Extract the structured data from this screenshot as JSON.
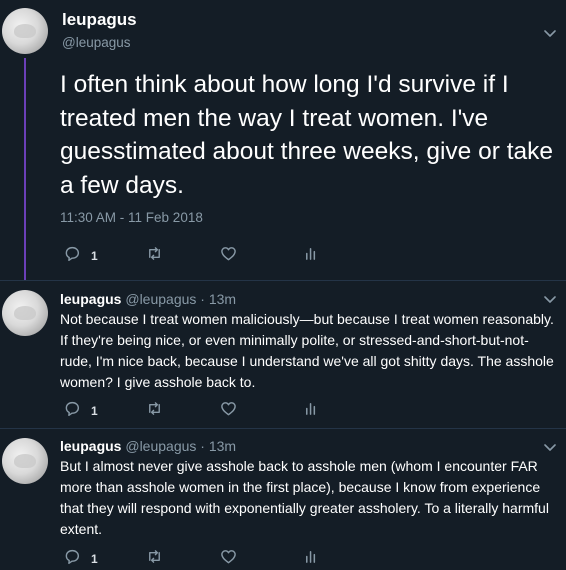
{
  "main_tweet": {
    "name": "leupagus",
    "handle": "@leupagus",
    "text": "I often think about how long I'd survive if I treated men the way I treat women. I've guesstimated about three weeks, give or take a few days.",
    "timestamp": "11:30 AM - 11 Feb 2018",
    "reply_count": "1",
    "icons": [
      "reply-icon",
      "retweet-icon",
      "like-icon",
      "analytics-icon",
      "chevron-down-icon"
    ]
  },
  "replies": [
    {
      "name": "leupagus",
      "handle": "@leupagus",
      "separator": " · ",
      "time": "13m",
      "text": "Not because I treat women maliciously—but because I treat women reasonably. If they're being nice, or even minimally polite, or stressed-and-short-but-not-rude, I'm nice back, because I understand we've all got shitty days. The asshole women? I give asshole back to.",
      "reply_count": "1"
    },
    {
      "name": "leupagus",
      "handle": "@leupagus",
      "separator": " · ",
      "time": "13m",
      "text": "But I almost never give asshole back to asshole men (whom I encounter FAR more than asshole women in the first place), because I know from experience that they will respond with exponentially greater assholery. To a literally harmful extent.",
      "reply_count": "1"
    }
  ],
  "colors": {
    "background": "#141d26",
    "text": "#ffffff",
    "muted": "#8899a6",
    "thread_line": "#6c3fb8",
    "divider": "#243447"
  }
}
